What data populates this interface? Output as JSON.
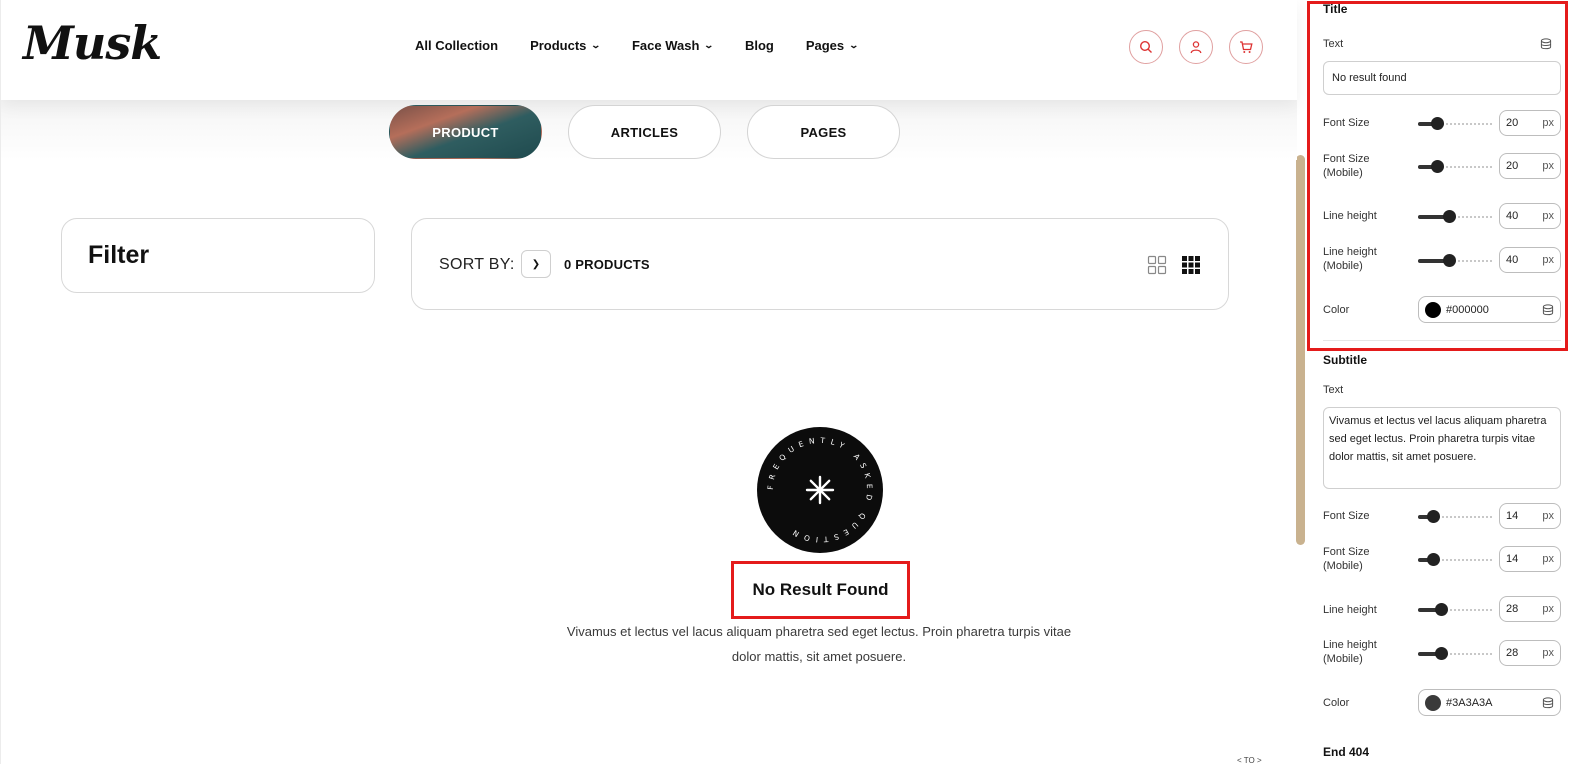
{
  "brand": {
    "logo": "Musk"
  },
  "nav": [
    {
      "label": "All Collection",
      "has_dropdown": false
    },
    {
      "label": "Products",
      "has_dropdown": true
    },
    {
      "label": "Face Wash",
      "has_dropdown": true
    },
    {
      "label": "Blog",
      "has_dropdown": false
    },
    {
      "label": "Pages",
      "has_dropdown": true
    }
  ],
  "header_icons": [
    "search-icon",
    "user-icon",
    "cart-icon"
  ],
  "search_tabs": [
    {
      "label": "PRODUCT",
      "active": true
    },
    {
      "label": "ARTICLES",
      "active": false
    },
    {
      "label": "PAGES",
      "active": false
    }
  ],
  "filter": {
    "title": "Filter"
  },
  "sort": {
    "label": "SORT BY:",
    "count": "0 PRODUCTS",
    "view_icons": [
      "grid-2x2-icon",
      "grid-3x3-icon"
    ]
  },
  "badge": {
    "ring_text": "FREQUENTLY ASKED QUESTION"
  },
  "no_result": {
    "title": "No Result Found",
    "description": "Vivamus et lectus vel lacus aliquam pharetra sed eget lectus. Proin pharetra turpis vitae dolor mattis, sit amet posuere."
  },
  "scroll_hint": "< TO >",
  "colors": {
    "accent_red": "#e41b1b",
    "scrollbar": "#c9b28f",
    "title_color": "#000000",
    "subtitle_color": "#3A3A3A"
  },
  "panel": {
    "title_section": {
      "heading": "Title",
      "text_label": "Text",
      "text_value": "No result found",
      "font_size": {
        "label": "Font Size",
        "value": "20",
        "unit": "px",
        "fraction": 0.25
      },
      "font_size_mobile": {
        "label": "Font Size (Mobile)",
        "value": "20",
        "unit": "px",
        "fraction": 0.25
      },
      "line_height": {
        "label": "Line height",
        "value": "40",
        "unit": "px",
        "fraction": 0.42
      },
      "line_height_mobile": {
        "label": "Line height (Mobile)",
        "value": "40",
        "unit": "px",
        "fraction": 0.42
      },
      "color": {
        "label": "Color",
        "value": "#000000"
      }
    },
    "subtitle_section": {
      "heading": "Subtitle",
      "text_label": "Text",
      "text_value": "Vivamus et lectus vel lacus aliquam pharetra sed eget lectus. Proin pharetra turpis vitae dolor mattis, sit amet posuere.",
      "font_size": {
        "label": "Font Size",
        "value": "14",
        "unit": "px",
        "fraction": 0.2
      },
      "font_size_mobile": {
        "label": "Font Size (Mobile)",
        "value": "14",
        "unit": "px",
        "fraction": 0.2
      },
      "line_height": {
        "label": "Line height",
        "value": "28",
        "unit": "px",
        "fraction": 0.31
      },
      "line_height_mobile": {
        "label": "Line height (Mobile)",
        "value": "28",
        "unit": "px",
        "fraction": 0.31
      },
      "color": {
        "label": "Color",
        "value": "#3A3A3A"
      }
    },
    "end_section": {
      "heading": "End 404"
    }
  }
}
